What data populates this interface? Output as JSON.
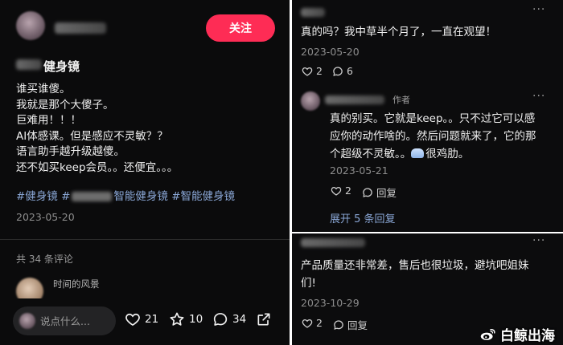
{
  "left": {
    "follow_label": "关注",
    "title": "健身镜",
    "body_lines": [
      "谁买谁傻。",
      "我就是那个大傻子。",
      "巨难用！！！",
      "AI体感课。但是感应不灵敏？？",
      "语言助手越升级越傻。",
      "还不如买keep会员。。还便宜。。。"
    ],
    "tag1": "#健身镜",
    "tag2_prefix": "#",
    "tag2_suffix": "智能健身镜",
    "tag3": "#智能健身镜",
    "date": "2023-05-20",
    "comment_count": "共 34 条评论",
    "preview_name": "时间的风景",
    "input_placeholder": "说点什么...",
    "likes": "21",
    "stars": "10",
    "comments": "34"
  },
  "right_top": {
    "comment1": {
      "text": "真的吗？我中草半个月了，一直在观望！",
      "date": "2023-05-20",
      "likes": "2",
      "replies": "6"
    },
    "comment2": {
      "author_tag": "作者",
      "lines": [
        "真的别买。它就是keep。。只不过它可以感",
        "应你的动作啥的。然后问题就来了，它的那",
        "个超级不灵敏。。"
      ],
      "tail": "很鸡肋。",
      "date": "2023-05-21",
      "likes": "2",
      "reply_label": "回复"
    },
    "expand_label": "展开 5 条回复"
  },
  "right_bottom": {
    "lines": [
      "产品质量还非常差，售后也很垃圾，避坑吧姐妹",
      "们!"
    ],
    "date": "2023-10-29",
    "likes": "2",
    "reply_label": "回复"
  },
  "watermark": "白鲸出海",
  "colors": {
    "accent": "#fe2c55",
    "tag": "#8aa7d6",
    "bg": "#0b0b0c"
  }
}
